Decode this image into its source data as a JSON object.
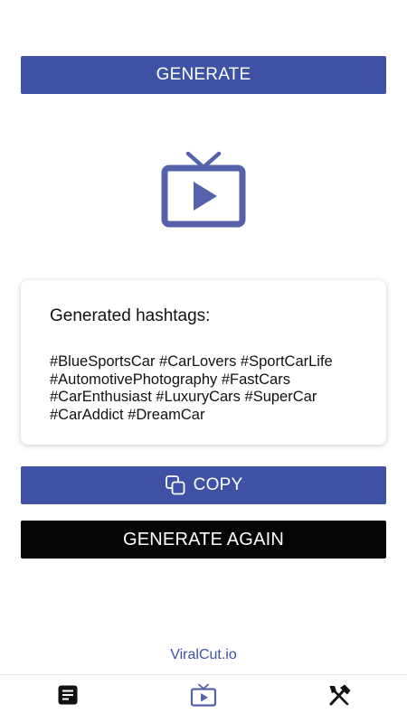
{
  "colors": {
    "primary": "#3f51a4",
    "dark_button": "#040606",
    "text": "#111111",
    "link": "#3f51a4"
  },
  "generate_button": {
    "label": "GENERATE"
  },
  "hero": {
    "icon": "tv-play-icon"
  },
  "hashtags_card": {
    "title": "Generated hashtags:",
    "hashtags": "#BlueSportsCar #CarLovers #SportCarLife #AutomotivePhotography #FastCars #CarEnthusiast #LuxuryCars #SuperCar #CarAddict #DreamCar"
  },
  "copy_button": {
    "label": "COPY",
    "icon": "copy-icon"
  },
  "generate_again_button": {
    "label": "GENERATE AGAIN"
  },
  "footer": {
    "link_text": "ViralCut.io"
  },
  "tabbar": {
    "tabs": [
      {
        "icon": "document-icon"
      },
      {
        "icon": "tv-play-icon",
        "active": true
      },
      {
        "icon": "tools-icon"
      }
    ]
  }
}
